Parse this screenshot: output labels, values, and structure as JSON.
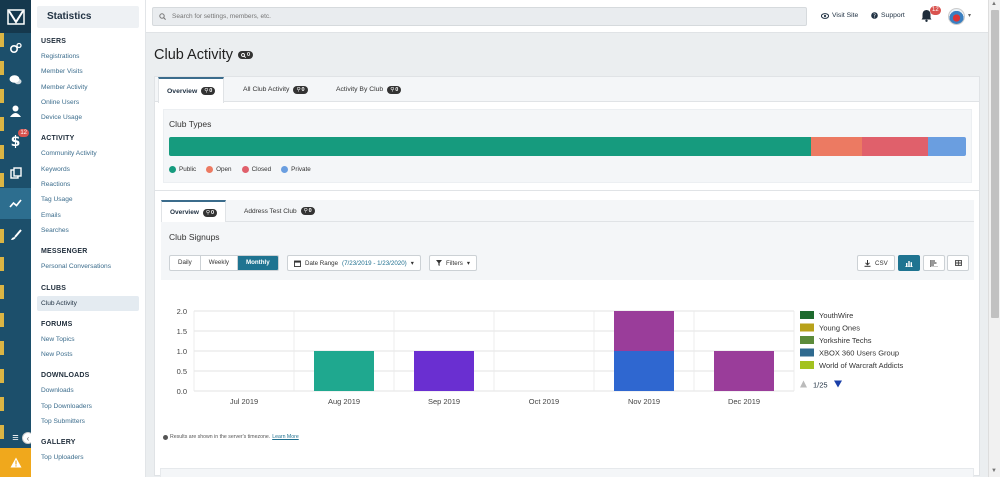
{
  "sidebar": {
    "title": "Statistics",
    "sections": [
      {
        "heading": "USERS",
        "items": [
          "Registrations",
          "Member Visits",
          "Member Activity",
          "Online Users",
          "Device Usage"
        ]
      },
      {
        "heading": "ACTIVITY",
        "items": [
          "Community Activity",
          "Keywords",
          "Reactions",
          "Tag Usage",
          "Emails",
          "Searches"
        ]
      },
      {
        "heading": "MESSENGER",
        "items": [
          "Personal Conversations"
        ]
      },
      {
        "heading": "CLUBS",
        "items": [
          "Club Activity"
        ]
      },
      {
        "heading": "FORUMS",
        "items": [
          "New Topics",
          "New Posts"
        ]
      },
      {
        "heading": "DOWNLOADS",
        "items": [
          "Downloads",
          "Top Downloaders",
          "Top Submitters"
        ]
      },
      {
        "heading": "GALLERY",
        "items": [
          "Top Uploaders"
        ]
      }
    ],
    "active_item": "Club Activity"
  },
  "rail": {
    "badge": "12"
  },
  "topbar": {
    "search_placeholder": "Search for settings, members, etc.",
    "visit_site": "Visit Site",
    "support": "Support",
    "notif_count": "12"
  },
  "page": {
    "title": "Club Activity",
    "title_badge": "0"
  },
  "tabs": [
    {
      "label": "Overview",
      "badge": "0"
    },
    {
      "label": "All Club Activity",
      "badge": "0"
    },
    {
      "label": "Activity By Club",
      "badge": "0"
    }
  ],
  "club_types": {
    "title": "Club Types",
    "segments": [
      {
        "name": "Public",
        "value": 80.5,
        "color": "#169b7e"
      },
      {
        "name": "Open",
        "value": 6.5,
        "color": "#ec7a62"
      },
      {
        "name": "Closed",
        "value": 8.2,
        "color": "#e0606b"
      },
      {
        "name": "Private",
        "value": 4.8,
        "color": "#6a9ee0"
      }
    ]
  },
  "inner_tabs": [
    {
      "label": "Overview",
      "badge": "0"
    },
    {
      "label": "Address Test Club",
      "badge": "0"
    }
  ],
  "signups": {
    "title": "Club Signups",
    "periods": [
      "Daily",
      "Weekly",
      "Monthly"
    ],
    "active_period": "Monthly",
    "date_range_label": "Date Range",
    "date_range_value": "(7/23/2019 - 1/23/2020)",
    "filters_label": "Filters",
    "csv_label": "CSV"
  },
  "chart_data": {
    "type": "bar",
    "categories": [
      "Jul 2019",
      "Aug 2019",
      "Sep 2019",
      "Oct 2019",
      "Nov 2019",
      "Dec 2019"
    ],
    "ylim": [
      0,
      2.0
    ],
    "yticks": [
      "0.0",
      "0.5",
      "1.0",
      "1.5",
      "2.0"
    ],
    "stacked": true,
    "grid": true,
    "legend_placement": "right",
    "bars": [
      [],
      [
        {
          "value": 1.0,
          "color": "#1fa88f"
        }
      ],
      [
        {
          "value": 1.0,
          "color": "#6a2fd1"
        }
      ],
      [],
      [
        {
          "value": 1.0,
          "color": "#2f67d0"
        },
        {
          "value": 1.0,
          "color": "#9a3d9a"
        }
      ],
      [
        {
          "value": 1.0,
          "color": "#9a3d9a"
        }
      ]
    ],
    "legend": [
      {
        "name": "YouthWire",
        "color": "#1e6b2e"
      },
      {
        "name": "Young Ones",
        "color": "#b8a21a"
      },
      {
        "name": "Yorkshire Techs",
        "color": "#5c8b3a"
      },
      {
        "name": "XBOX 360 Users Group",
        "color": "#2f6a8f"
      },
      {
        "name": "World of Warcraft Addicts",
        "color": "#a3c21f"
      }
    ],
    "legend_page": "1/25"
  },
  "note": {
    "text": "Results are shown in the server's timezone.",
    "link": "Learn More"
  }
}
